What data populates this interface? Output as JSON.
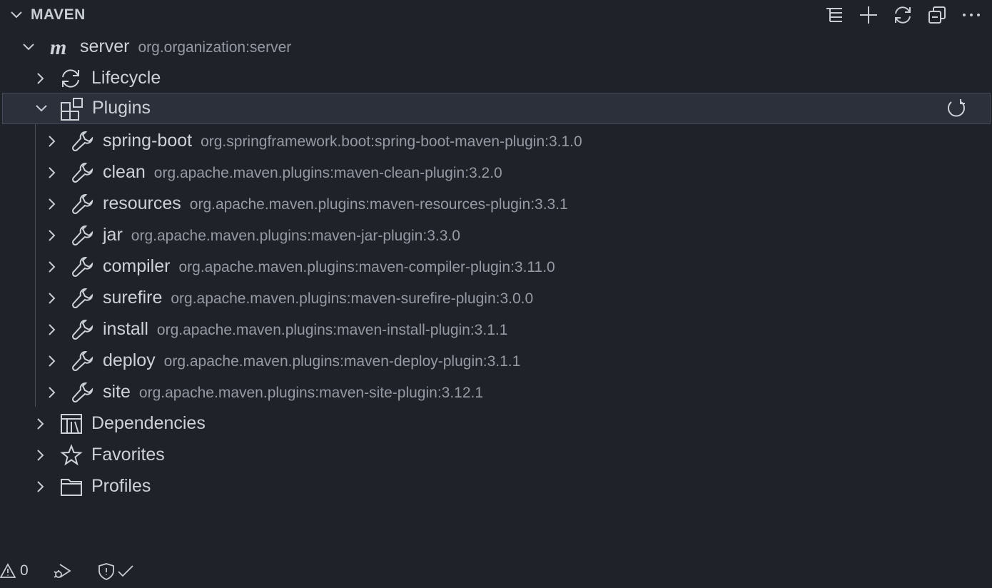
{
  "header": {
    "title": "MAVEN"
  },
  "project": {
    "name": "server",
    "coordinates": "org.organization:server"
  },
  "nodes": {
    "lifecycle": "Lifecycle",
    "plugins": "Plugins",
    "dependencies": "Dependencies",
    "favorites": "Favorites",
    "profiles": "Profiles"
  },
  "plugins": [
    {
      "name": "spring-boot",
      "coordinates": "org.springframework.boot:spring-boot-maven-plugin:3.1.0"
    },
    {
      "name": "clean",
      "coordinates": "org.apache.maven.plugins:maven-clean-plugin:3.2.0"
    },
    {
      "name": "resources",
      "coordinates": "org.apache.maven.plugins:maven-resources-plugin:3.3.1"
    },
    {
      "name": "jar",
      "coordinates": "org.apache.maven.plugins:maven-jar-plugin:3.3.0"
    },
    {
      "name": "compiler",
      "coordinates": "org.apache.maven.plugins:maven-compiler-plugin:3.11.0"
    },
    {
      "name": "surefire",
      "coordinates": "org.apache.maven.plugins:maven-surefire-plugin:3.0.0"
    },
    {
      "name": "install",
      "coordinates": "org.apache.maven.plugins:maven-install-plugin:3.1.1"
    },
    {
      "name": "deploy",
      "coordinates": "org.apache.maven.plugins:maven-deploy-plugin:3.1.1"
    },
    {
      "name": "site",
      "coordinates": "org.apache.maven.plugins:maven-site-plugin:3.12.1"
    }
  ],
  "status": {
    "warnings": "0"
  },
  "icons": {
    "header_actions": [
      "tree-icon",
      "plus-icon",
      "sync-icon",
      "collapse-all-icon",
      "more-icon"
    ],
    "status": [
      "warning-icon",
      "debug-icon",
      "shield-check-icon"
    ]
  },
  "colors": {
    "background": "#1f2228",
    "selected": "#2c303a",
    "text": "#cdd1d8",
    "muted": "#959aa4"
  }
}
